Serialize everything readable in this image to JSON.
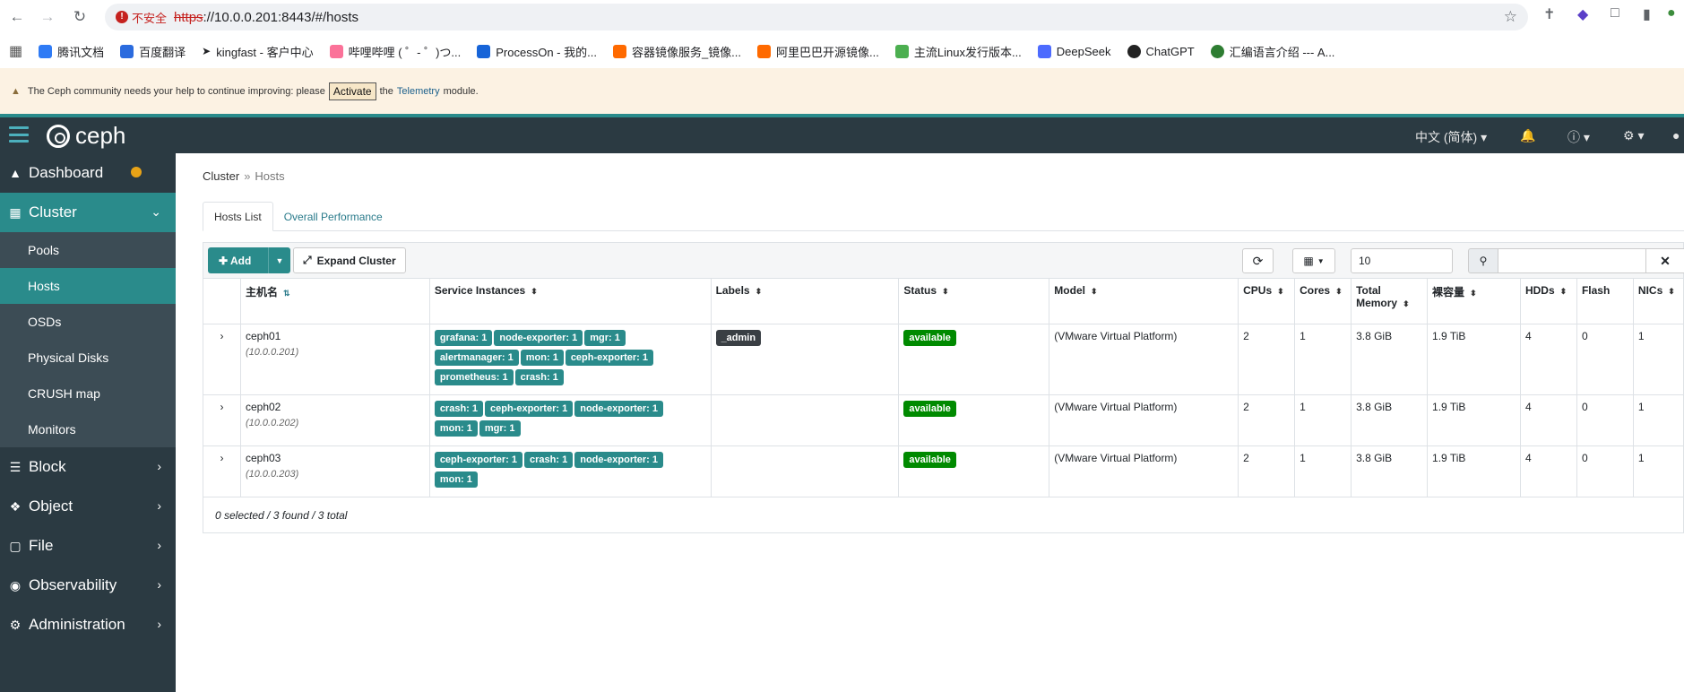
{
  "browser": {
    "security_label": "不安全",
    "url_scheme": "https",
    "url_rest": "://10.0.0.201:8443/#/hosts",
    "bookmarks": [
      "腾讯文档",
      "百度翻译",
      "kingfast - 客户中心",
      "哔哩哔哩 ( ゜- ゜)つ...",
      "ProcessOn - 我的...",
      "容器镜像服务_镜像...",
      "阿里巴巴开源镜像...",
      "主流Linux发行版本...",
      "DeepSeek",
      "ChatGPT",
      "汇编语言介绍 --- A..."
    ]
  },
  "banner": {
    "text_before": "The Ceph community needs your help to continue improving: please",
    "activate_label": "Activate",
    "text_the": "the",
    "telemetry_label": "Telemetry",
    "text_after": "module."
  },
  "topnav": {
    "brand": "ceph",
    "language": "中文 (简体)"
  },
  "sidebar": {
    "dashboard": "Dashboard",
    "cluster": "Cluster",
    "cluster_items": [
      "Pools",
      "Hosts",
      "OSDs",
      "Physical Disks",
      "CRUSH map",
      "Monitors"
    ],
    "block": "Block",
    "object": "Object",
    "file": "File",
    "observability": "Observability",
    "administration": "Administration"
  },
  "breadcrumb": {
    "root": "Cluster",
    "sep": "»",
    "current": "Hosts"
  },
  "tabs": [
    "Hosts List",
    "Overall Performance"
  ],
  "toolbar": {
    "add_label": "Add",
    "expand_label": "Expand Cluster",
    "page_size": "10",
    "search_placeholder": ""
  },
  "table": {
    "headers": [
      "主机名",
      "Service Instances",
      "Labels",
      "Status",
      "Model",
      "CPUs",
      "Cores",
      "Total Memory",
      "裸容量",
      "HDDs",
      "Flash",
      "NICs"
    ],
    "rows": [
      {
        "hostname": "ceph01",
        "ip": "(10.0.0.201)",
        "services": [
          "grafana: 1",
          "node-exporter: 1",
          "mgr: 1",
          "alertmanager: 1",
          "mon: 1",
          "ceph-exporter: 1",
          "prometheus: 1",
          "crash: 1"
        ],
        "labels": [
          "_admin"
        ],
        "status": "available",
        "model": "(VMware Virtual Platform)",
        "cpus": "2",
        "cores": "1",
        "memory": "3.8 GiB",
        "raw_capacity": "1.9 TiB",
        "hdds": "4",
        "flash": "0",
        "nics": "1"
      },
      {
        "hostname": "ceph02",
        "ip": "(10.0.0.202)",
        "services": [
          "crash: 1",
          "ceph-exporter: 1",
          "node-exporter: 1",
          "mon: 1",
          "mgr: 1"
        ],
        "labels": [],
        "status": "available",
        "model": "(VMware Virtual Platform)",
        "cpus": "2",
        "cores": "1",
        "memory": "3.8 GiB",
        "raw_capacity": "1.9 TiB",
        "hdds": "4",
        "flash": "0",
        "nics": "1"
      },
      {
        "hostname": "ceph03",
        "ip": "(10.0.0.203)",
        "services": [
          "ceph-exporter: 1",
          "crash: 1",
          "node-exporter: 1",
          "mon: 1"
        ],
        "labels": [],
        "status": "available",
        "model": "(VMware Virtual Platform)",
        "cpus": "2",
        "cores": "1",
        "memory": "3.8 GiB",
        "raw_capacity": "1.9 TiB",
        "hdds": "4",
        "flash": "0",
        "nics": "1"
      }
    ],
    "footer": "0 selected / 3 found / 3 total"
  }
}
